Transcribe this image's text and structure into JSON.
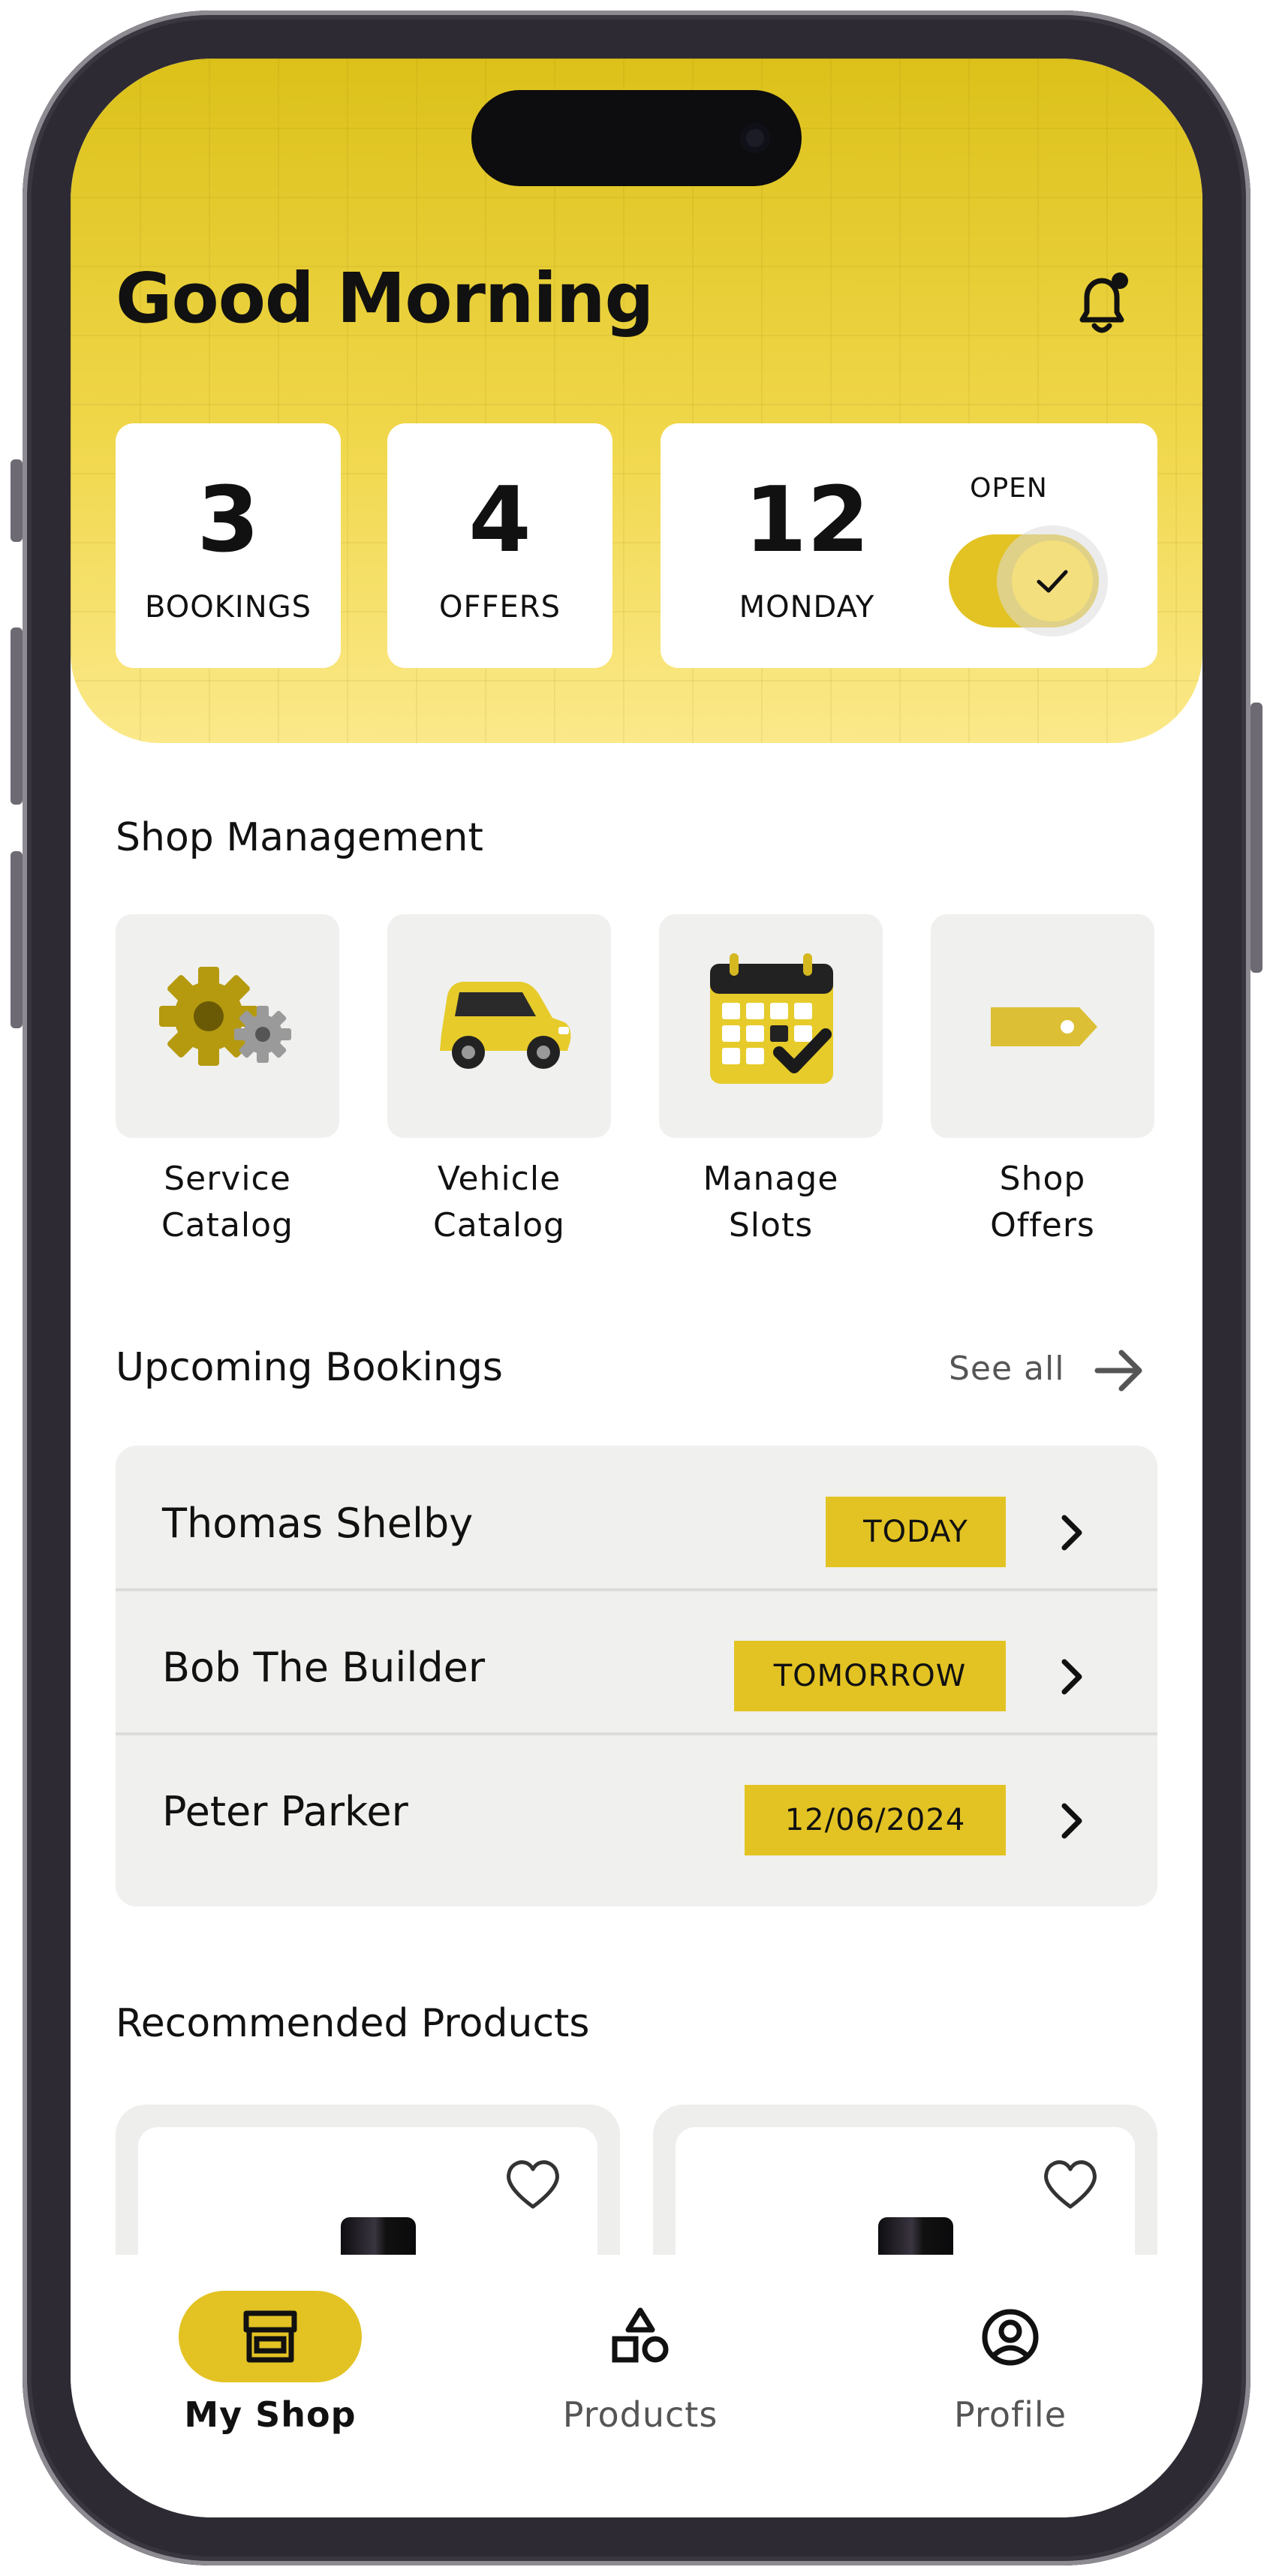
{
  "header": {
    "greeting": "Good Morning"
  },
  "stats": {
    "bookings": {
      "value": "3",
      "label": "BOOKINGS"
    },
    "offers": {
      "value": "4",
      "label": "OFFERS"
    },
    "date": {
      "day": "12",
      "weekday": "MONDAY"
    },
    "status": {
      "label": "OPEN",
      "toggle_on": true
    }
  },
  "shop_management": {
    "title": "Shop Management",
    "items": [
      {
        "line1": "Service",
        "line2": "Catalog",
        "icon": "gears-icon"
      },
      {
        "line1": "Vehicle",
        "line2": "Catalog",
        "icon": "car-icon"
      },
      {
        "line1": "Manage",
        "line2": "Slots",
        "icon": "calendar-icon"
      },
      {
        "line1": "Shop",
        "line2": "Offers",
        "icon": "tag-icon"
      }
    ]
  },
  "upcoming_bookings": {
    "title": "Upcoming Bookings",
    "see_all": "See all",
    "items": [
      {
        "name": "Thomas Shelby",
        "when": "TODAY"
      },
      {
        "name": "Bob The Builder",
        "when": "TOMORROW"
      },
      {
        "name": "Peter Parker",
        "when": "12/06/2024"
      }
    ]
  },
  "recommended_products": {
    "title": "Recommended Products"
  },
  "tabbar": {
    "items": [
      {
        "label": "My Shop",
        "active": true,
        "icon": "store-icon"
      },
      {
        "label": "Products",
        "active": false,
        "icon": "shapes-icon"
      },
      {
        "label": "Profile",
        "active": false,
        "icon": "profile-icon"
      }
    ]
  },
  "colors": {
    "accent": "#e3c323",
    "header_top": "#dcc11a",
    "header_bottom": "#fbe98a",
    "card_bg": "#f0f0ee"
  }
}
